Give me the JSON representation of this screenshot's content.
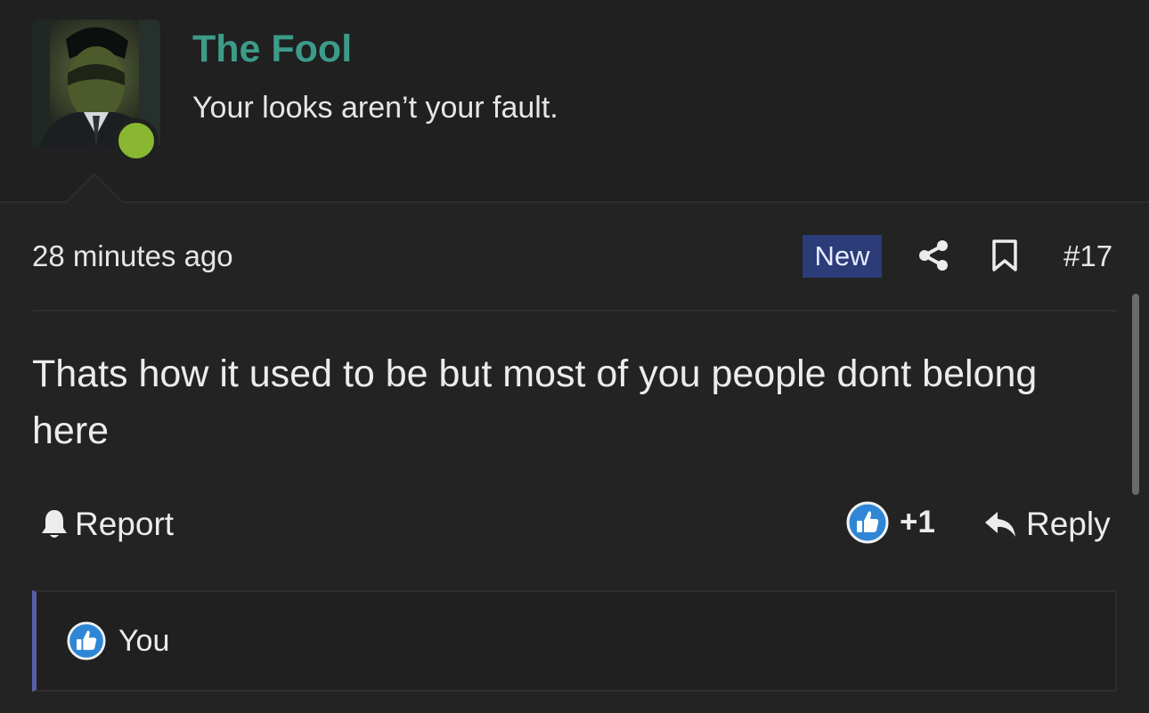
{
  "user": {
    "name": "The Fool",
    "title": "Your looks aren’t your fault.",
    "status": "online",
    "status_color": "#8ab731",
    "name_color": "#3d9b8a"
  },
  "post": {
    "time": "28 minutes ago",
    "badge": "New",
    "number": "#17",
    "body": "Thats how it used to be but most of you people dont belong here"
  },
  "actions": {
    "report_label": "Report",
    "reaction_count": "+1",
    "reply_label": "Reply"
  },
  "reactions": {
    "type": "like",
    "users": "You"
  },
  "icons": {
    "share": "share-icon",
    "bookmark": "bookmark-icon",
    "report": "bell-icon",
    "like": "thumbs-up-icon",
    "reply": "reply-arrow-icon"
  },
  "colors": {
    "background": "#232323",
    "badge_bg": "#2c3c78",
    "like_blue": "#2f86d6",
    "reactions_accent": "#5a5fa8"
  }
}
